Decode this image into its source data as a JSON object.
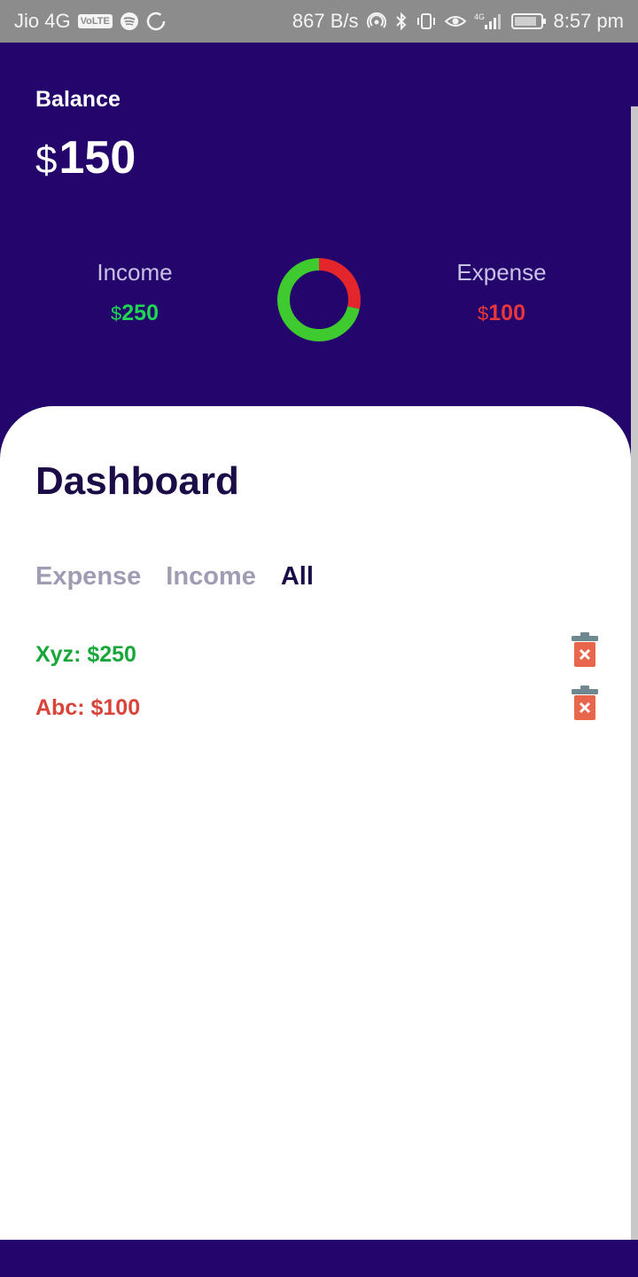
{
  "status_bar": {
    "carrier": "Jio 4G",
    "volte": "VoLTE",
    "net_speed": "867 B/s",
    "network_type": "4G",
    "battery": "77",
    "time": "8:57 pm",
    "icons": [
      "spotify-icon",
      "sync-icon",
      "hotspot-icon",
      "bluetooth-icon",
      "vibrate-icon",
      "eye-icon",
      "signal-icon",
      "battery-icon"
    ]
  },
  "header": {
    "balance_label": "Balance",
    "currency": "$",
    "balance_value": "150",
    "income_label": "Income",
    "income_value": "250",
    "expense_label": "Expense",
    "expense_value": "100"
  },
  "chart_data": {
    "type": "pie",
    "donut": true,
    "categories": [
      "Income",
      "Expense"
    ],
    "values": [
      250,
      100
    ],
    "colors": [
      "#3fcb2f",
      "#e3262b"
    ]
  },
  "dashboard": {
    "title": "Dashboard",
    "tabs": [
      {
        "label": "Expense",
        "active": false
      },
      {
        "label": "Income",
        "active": false
      },
      {
        "label": "All",
        "active": true
      }
    ],
    "transactions": [
      {
        "text": "Xyz: $250",
        "type": "income"
      },
      {
        "text": "Abc: $100",
        "type": "expense"
      }
    ]
  },
  "colors": {
    "header_bg": "#23056b",
    "income_green": "#1fd655",
    "expense_red": "#e8363c",
    "trash_icon": "#e8664c",
    "trash_lid": "#6f8790"
  }
}
